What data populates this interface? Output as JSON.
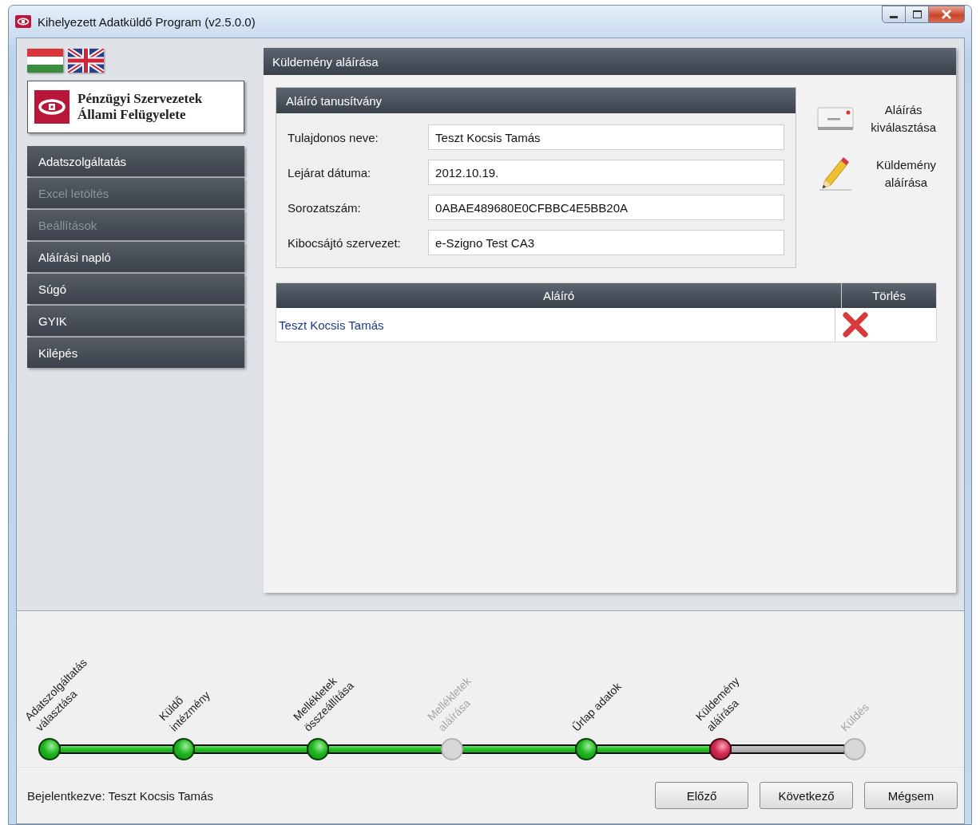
{
  "window": {
    "title": "Kihelyezett Adatküldő Program (v2.5.0.0)"
  },
  "logo": {
    "text": "Pénzügyi Szervezetek\nÁllami Felügyelete"
  },
  "menu": [
    {
      "label": "Adatszolgáltatás",
      "disabled": false
    },
    {
      "label": "Excel letöltés",
      "disabled": true
    },
    {
      "label": "Beállítások",
      "disabled": true
    },
    {
      "label": "Aláírási napló",
      "disabled": false
    },
    {
      "label": "Súgó",
      "disabled": false
    },
    {
      "label": "GYIK",
      "disabled": false
    },
    {
      "label": "Kilépés",
      "disabled": false
    }
  ],
  "panel": {
    "title": "Küldemény aláírása",
    "certificate": {
      "title": "Aláíró tanusítvány",
      "fields": [
        {
          "label": "Tulajdonos neve:",
          "value": "Teszt Kocsis Tamás"
        },
        {
          "label": "Lejárat dátuma:",
          "value": "2012.10.19."
        },
        {
          "label": "Sorozatszám:",
          "value": "0ABAE489680E0CFBBC4E5BB20A"
        },
        {
          "label": "Kibocsájtó szervezet:",
          "value": "e-Szigno Test CA3"
        }
      ]
    },
    "actions": [
      {
        "kind": "select",
        "label": "Aláírás\nkiválasztása"
      },
      {
        "kind": "sign",
        "label": "Küldemény\naláírása"
      }
    ],
    "table": {
      "columns": [
        "Aláíró",
        "Törlés"
      ],
      "rows": [
        {
          "signer": "Teszt Kocsis Tamás"
        }
      ]
    }
  },
  "steps": [
    {
      "label": "Adatszolgáltatás\nválasztása",
      "kind": "done"
    },
    {
      "label": "Küldő\nintézmény",
      "kind": "done"
    },
    {
      "label": "Mellékletek\nösszeállítása",
      "kind": "done"
    },
    {
      "label": "Mellékletek\naláírása",
      "kind": "skipped"
    },
    {
      "label": "Űrlap adatok",
      "kind": "done"
    },
    {
      "label": "Küldemény\naláírása",
      "kind": "current"
    },
    {
      "label": "Küldés",
      "kind": "pending"
    }
  ],
  "status_bar": {
    "text": "Bejelentkezve: Teszt Kocsis Tamás"
  },
  "buttons": [
    "Előző",
    "Következő",
    "Mégsem"
  ]
}
